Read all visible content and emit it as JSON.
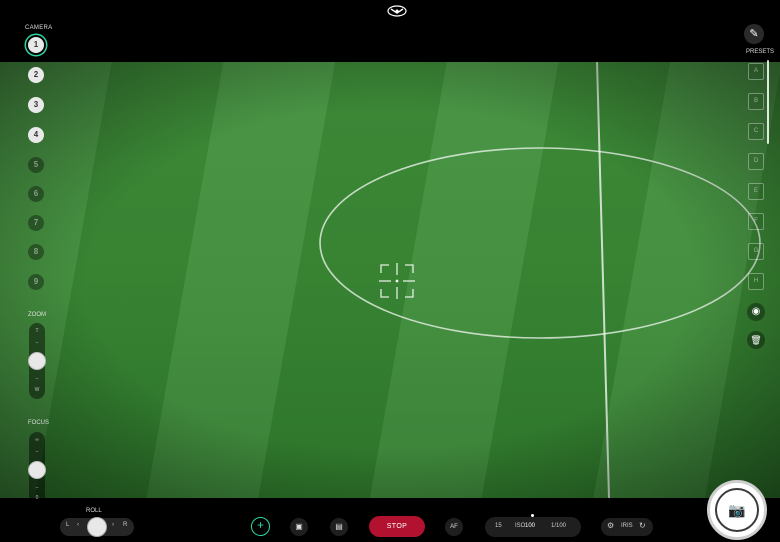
{
  "camera": {
    "label": "CAMERA",
    "buttons": [
      "1",
      "2",
      "3",
      "4",
      "5",
      "6",
      "7",
      "8",
      "9"
    ],
    "selected": "1",
    "enabled": [
      "1",
      "2",
      "3",
      "4"
    ]
  },
  "zoom": {
    "label": "ZOOM",
    "tele": "T",
    "wide": "W",
    "level": 0.5
  },
  "focus": {
    "label": "FOCUS",
    "top": "∞",
    "bottom": "0",
    "level": 0.5
  },
  "presets": {
    "label": "PRESETS",
    "items": [
      "A",
      "B",
      "C",
      "D",
      "E",
      "F",
      "G",
      "H"
    ]
  },
  "roll": {
    "label": "ROLL",
    "left": "L",
    "right": "R",
    "level": 0.5
  },
  "controls": {
    "stop_label": "STOP",
    "af_label": "AF",
    "exposure_left": "15",
    "iso_label": "ISO",
    "iso_value": "100",
    "shutter": "1/100",
    "iris_label": "IRIS"
  },
  "icons": {
    "drone": "drone-icon",
    "tool": "wrench-icon",
    "record": "record-icon",
    "delete": "trash-icon",
    "center": "crosshair-icon",
    "capture": "camera-icon"
  },
  "colors": {
    "accent": "#2fd7a7",
    "stop": "#b2112f",
    "field": "#3a8a35"
  }
}
